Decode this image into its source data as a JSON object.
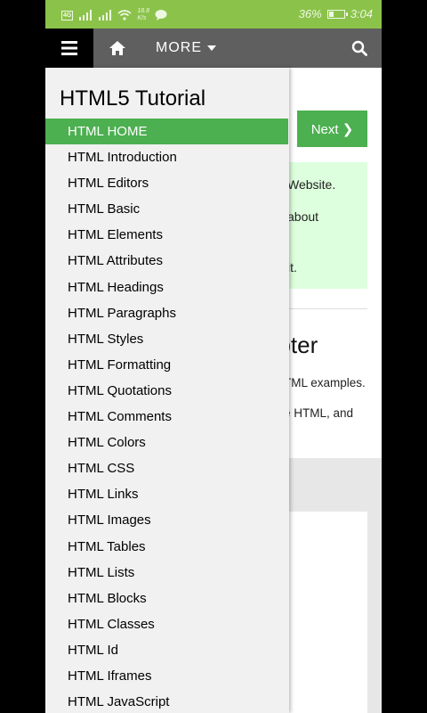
{
  "status_bar": {
    "network_label": "4G",
    "speed_value": "18.8",
    "speed_unit": "K/s",
    "battery_pct": "36%",
    "battery_level": 0.36,
    "time": "3:04"
  },
  "topnav": {
    "more_label": "MORE"
  },
  "background_page": {
    "next_label": "Next ❯",
    "note_lines": [
      "Website.",
      "about",
      "it."
    ],
    "chapter_heading": "apter",
    "chapter_lines": [
      "TML examples.",
      "e HTML, and"
    ]
  },
  "drawer": {
    "title": "HTML5 Tutorial",
    "active_index": 0,
    "items": [
      "HTML HOME",
      "HTML Introduction",
      "HTML Editors",
      "HTML Basic",
      "HTML Elements",
      "HTML Attributes",
      "HTML Headings",
      "HTML Paragraphs",
      "HTML Styles",
      "HTML Formatting",
      "HTML Quotations",
      "HTML Comments",
      "HTML Colors",
      "HTML CSS",
      "HTML Links",
      "HTML Images",
      "HTML Tables",
      "HTML Lists",
      "HTML Blocks",
      "HTML Classes",
      "HTML Id",
      "HTML Iframes",
      "HTML JavaScript"
    ]
  },
  "colors": {
    "status_bar": "#8bc34a",
    "accent_green": "#4caf50",
    "note_bg": "#ddffdd",
    "nav_bg": "#5f5f5f"
  },
  "icons": {
    "menu": "hamburger-icon",
    "home": "home-icon",
    "search": "search-icon"
  }
}
